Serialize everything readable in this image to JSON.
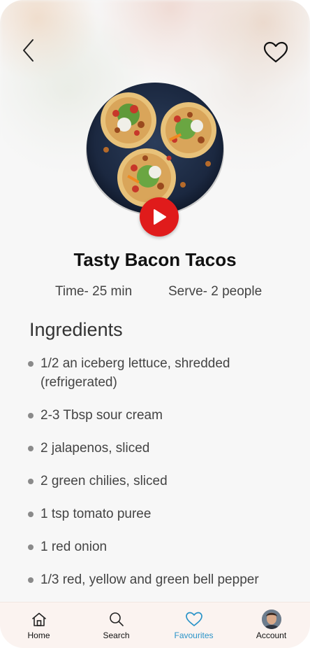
{
  "recipe": {
    "title": "Tasty Bacon Tacos",
    "time": "Time- 25 min",
    "serve": "Serve- 2 people"
  },
  "ingredients": {
    "heading": "Ingredients",
    "items": [
      "1/2 an iceberg lettuce, shredded (refrigerated)",
      "2-3 Tbsp sour cream",
      "2 jalapenos, sliced",
      "2 green chilies, sliced",
      "1 tsp tomato puree",
      "1 red onion",
      "1/3 red, yellow and green bell pepper"
    ]
  },
  "tabs": [
    {
      "label": "Home",
      "icon": "home-icon",
      "active": false
    },
    {
      "label": "Search",
      "icon": "search-icon",
      "active": false
    },
    {
      "label": "Favourites",
      "icon": "heart-icon",
      "active": true
    },
    {
      "label": "Account",
      "icon": "avatar",
      "active": false
    }
  ],
  "colors": {
    "accent": "#2a93c8",
    "play_button": "#e01b1b",
    "tabbar_bg": "#fbf3f0"
  }
}
